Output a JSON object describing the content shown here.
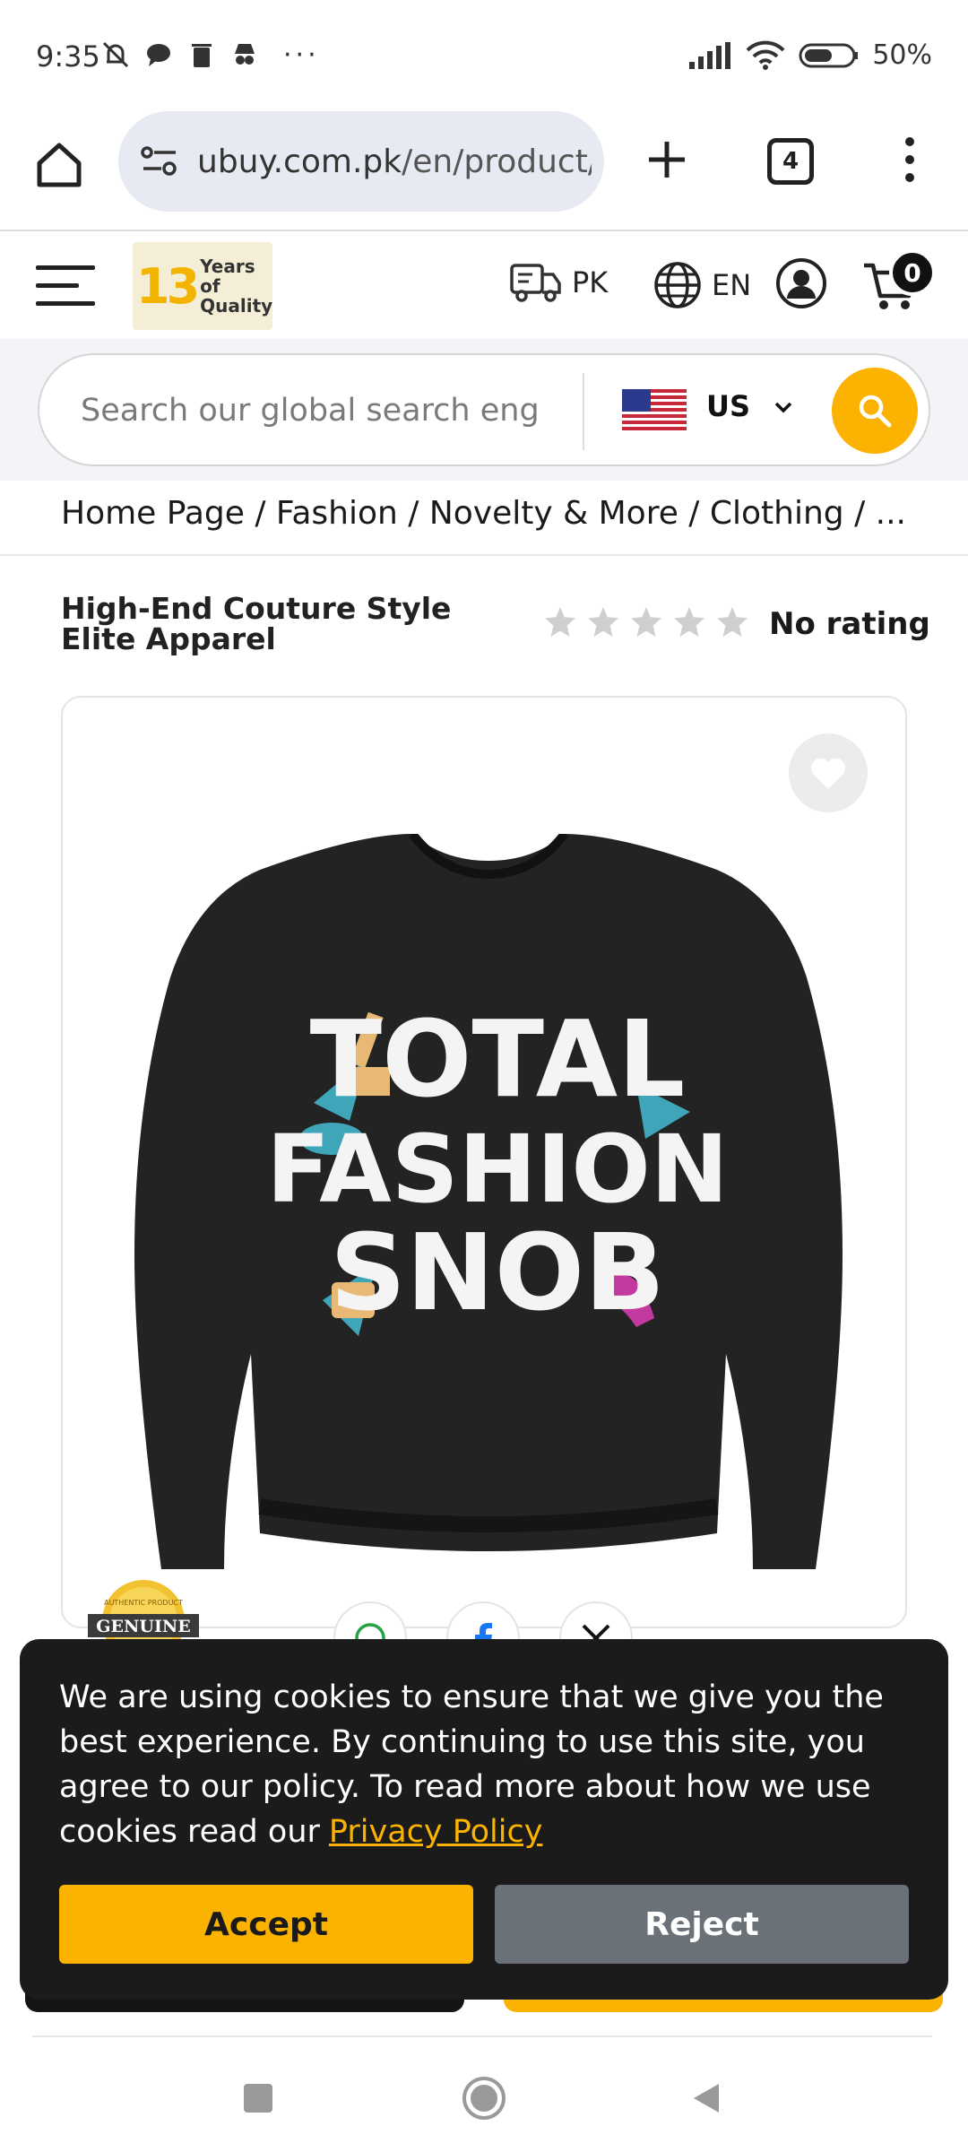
{
  "status_bar": {
    "time": "9:35",
    "more": "···",
    "battery": "50%"
  },
  "browser": {
    "url_domain": "ubuy.com.pk",
    "url_path": "/en/product/",
    "tab_count": "4"
  },
  "header": {
    "logo_number": "13",
    "logo_line1": "Years of",
    "logo_line2": "Quality",
    "shipping_country": "PK",
    "language": "EN",
    "cart_count": "0"
  },
  "search": {
    "placeholder": "Search our global search eng",
    "store_country": "US"
  },
  "breadcrumb": "Home Page / Fashion / Novelty & More / Clothing / ...",
  "product": {
    "title": "High-End Couture Style Elite Apparel",
    "rating_text": "No rating",
    "stars": 0,
    "graphic_line1": "TOTAL",
    "graphic_line2": "FASHION",
    "graphic_line3": "SNOB",
    "badge_top": "AUTHENTIC PRODUCT",
    "badge_label": "GENUINE"
  },
  "cookie": {
    "message": "We are using cookies to ensure that we give you the best experience. By continuing to use this site, you agree to our policy. To read more about how we use cookies read our",
    "link": "Privacy Policy",
    "accept": "Accept",
    "reject": "Reject"
  },
  "colors": {
    "accent": "#fbb200",
    "banner_bg": "#1b1b1b",
    "reject_bg": "#6b7178"
  }
}
